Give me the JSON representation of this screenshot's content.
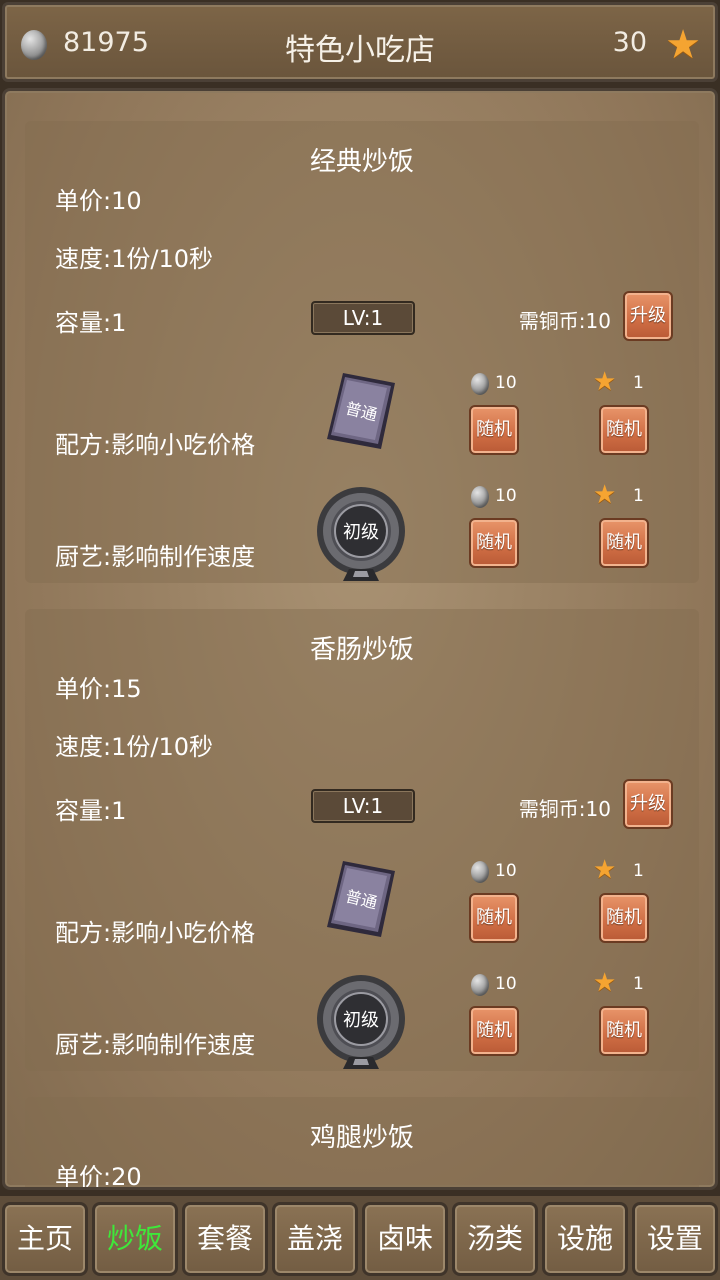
{
  "header": {
    "coins": "81975",
    "title": "特色小吃店",
    "stars": "30",
    "coin_icon": "silver-coin-icon",
    "star_icon": "star-icon"
  },
  "cards": [
    {
      "name": "经典炒饭",
      "price": "单价:10",
      "speed": "速度:1份/10秒",
      "capacity": "容量:1",
      "level": "LV:1",
      "need": "需铜币:10",
      "upgrade_label": "升级",
      "recipe_label": "配方:影响小吃价格",
      "recipe_badge": "普通",
      "recipe_coin_cost": "10",
      "recipe_star_cost": "1",
      "skill_label": "厨艺:影响制作速度",
      "skill_badge": "初级",
      "skill_coin_cost": "10",
      "skill_star_cost": "1",
      "random_label": "随机"
    },
    {
      "name": "香肠炒饭",
      "price": "单价:15",
      "speed": "速度:1份/10秒",
      "capacity": "容量:1",
      "level": "LV:1",
      "need": "需铜币:10",
      "upgrade_label": "升级",
      "recipe_label": "配方:影响小吃价格",
      "recipe_badge": "普通",
      "recipe_coin_cost": "10",
      "recipe_star_cost": "1",
      "skill_label": "厨艺:影响制作速度",
      "skill_badge": "初级",
      "skill_coin_cost": "10",
      "skill_star_cost": "1",
      "random_label": "随机"
    },
    {
      "name": "鸡腿炒饭",
      "price": "单价:20"
    }
  ],
  "tabs": [
    {
      "label": "主页"
    },
    {
      "label": "炒饭",
      "active": true
    },
    {
      "label": "套餐"
    },
    {
      "label": "盖浇"
    },
    {
      "label": "卤味"
    },
    {
      "label": "汤类"
    },
    {
      "label": "设施"
    },
    {
      "label": "设置"
    }
  ],
  "colors": {
    "active_tab": "#3ee83a",
    "button": "#cf6d44",
    "star": "#f5a431"
  }
}
